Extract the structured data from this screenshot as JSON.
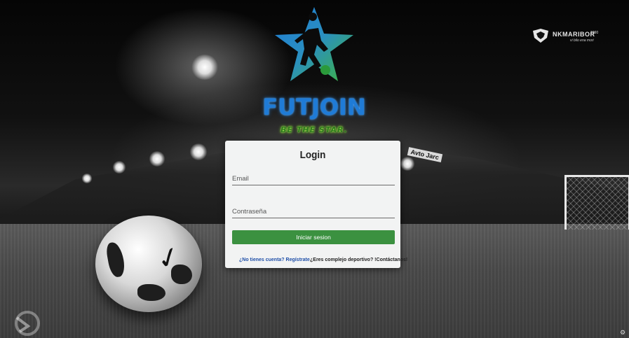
{
  "brand": {
    "name": "FUTJOIN",
    "tagline": "BE THE STAR."
  },
  "club": {
    "name": "NKMARIBOR",
    "year": "1960",
    "motto": "vi bilo ena mori"
  },
  "banners": {
    "right": "Avto Jarc"
  },
  "login": {
    "title": "Login",
    "email_placeholder": "Email",
    "password_placeholder": "Contraseña",
    "submit_label": "Iniciar sesion",
    "register_link": "¿No tienes cuenta? Regístrate",
    "contact_link": "¿Eres complejo deportivo? !Contáctanos!"
  },
  "colors": {
    "brand_blue": "#1f7bd6",
    "brand_green": "#37b24d",
    "button_green": "#3b9140",
    "link_blue": "#1f4fa8",
    "card_bg": "#f2f3f3"
  },
  "icons": {
    "logo": "star-player-icon",
    "club_badge": "shield-icon",
    "corner": "back-arrow-icon"
  }
}
